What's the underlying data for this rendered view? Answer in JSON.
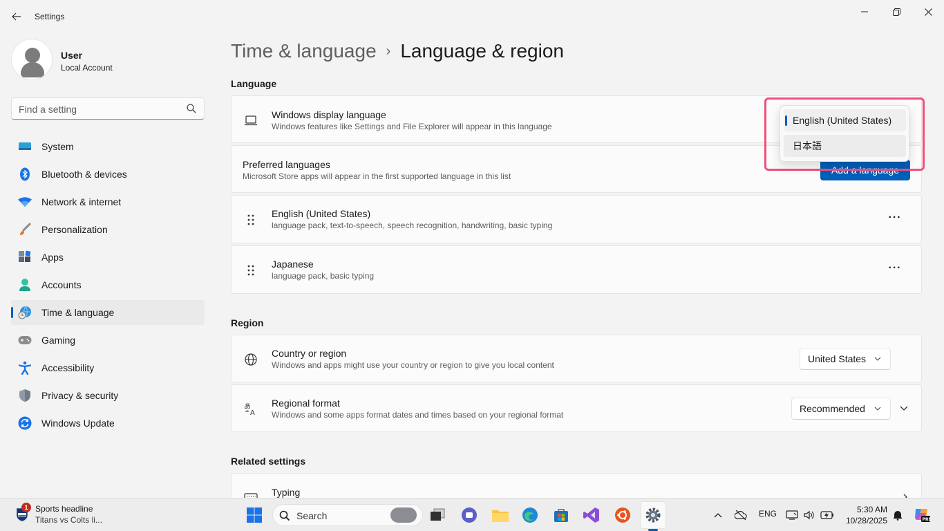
{
  "window": {
    "title": "Settings"
  },
  "profile": {
    "name": "User",
    "account_type": "Local Account"
  },
  "search": {
    "placeholder": "Find a setting"
  },
  "nav": [
    {
      "label": "System",
      "icon": "system-icon"
    },
    {
      "label": "Bluetooth & devices",
      "icon": "bluetooth-icon"
    },
    {
      "label": "Network & internet",
      "icon": "wifi-icon"
    },
    {
      "label": "Personalization",
      "icon": "brush-icon"
    },
    {
      "label": "Apps",
      "icon": "apps-icon"
    },
    {
      "label": "Accounts",
      "icon": "accounts-icon"
    },
    {
      "label": "Time & language",
      "icon": "time-language-icon",
      "active": true
    },
    {
      "label": "Gaming",
      "icon": "gamepad-icon"
    },
    {
      "label": "Accessibility",
      "icon": "accessibility-icon"
    },
    {
      "label": "Privacy & security",
      "icon": "shield-icon"
    },
    {
      "label": "Windows Update",
      "icon": "update-icon"
    }
  ],
  "breadcrumb": {
    "parent": "Time & language",
    "separator": "›",
    "current": "Language & region"
  },
  "language_section": {
    "title": "Language",
    "display_language": {
      "title": "Windows display language",
      "subtitle": "Windows features like Settings and File Explorer will appear in this language"
    },
    "preferred": {
      "title": "Preferred languages",
      "subtitle": "Microsoft Store apps will appear in the first supported language in this list",
      "add_button": "Add a language"
    },
    "languages": [
      {
        "name": "English (United States)",
        "features": "language pack, text-to-speech, speech recognition, handwriting, basic typing"
      },
      {
        "name": "Japanese",
        "features": "language pack, basic typing"
      }
    ],
    "more_label": "···"
  },
  "display_language_dropdown": {
    "options": [
      "English (United States)",
      "日本語"
    ],
    "selected": "English (United States)"
  },
  "region_section": {
    "title": "Region",
    "country": {
      "title": "Country or region",
      "subtitle": "Windows and apps might use your country or region to give you local content",
      "value": "United States"
    },
    "format": {
      "title": "Regional format",
      "subtitle": "Windows and some apps format dates and times based on your regional format",
      "value": "Recommended"
    }
  },
  "related_section": {
    "title": "Related settings",
    "typing": {
      "title": "Typing"
    }
  },
  "taskbar": {
    "news": {
      "badge": "1",
      "title": "Sports headline",
      "subtitle": "Titans vs Colts li..."
    },
    "search_label": "Search",
    "input_indicator": "ENG",
    "time": "5:30 AM",
    "date": "10/28/2025"
  },
  "colors": {
    "accent": "#005fb8",
    "highlight_border": "#ef4f7c"
  }
}
